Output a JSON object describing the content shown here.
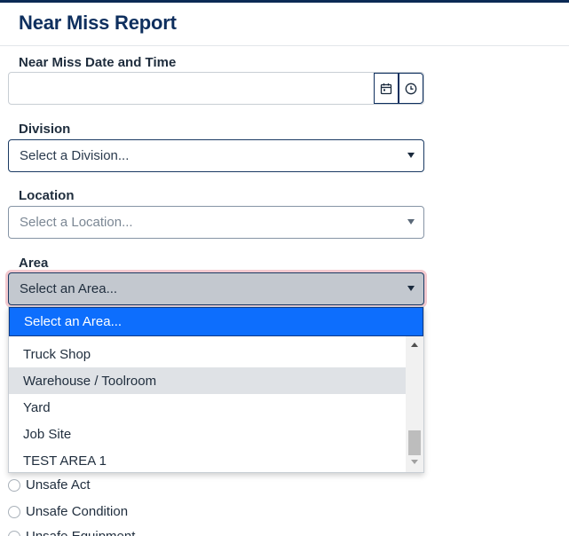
{
  "page": {
    "title": "Near Miss Report"
  },
  "datetime": {
    "label": "Near Miss Date and Time",
    "value": ""
  },
  "division": {
    "label": "Division",
    "placeholder": "Select a Division..."
  },
  "location": {
    "label": "Location",
    "placeholder": "Select a Location..."
  },
  "area": {
    "label": "Area",
    "placeholder": "Select an Area...",
    "dropdown": {
      "highlighted": "Select an Area...",
      "options": [
        "Truck Shop",
        "Warehouse / Toolroom",
        "Yard",
        "Job Site",
        "TEST AREA 1"
      ],
      "hovered": "Warehouse / Toolroom"
    }
  },
  "type_options": [
    "Unsafe Act",
    "Unsafe Condition",
    "Unsafe Equipment"
  ],
  "icons": {
    "calendar": "calendar-icon",
    "clock": "clock-icon"
  },
  "colors": {
    "brand": "#0e2f5e",
    "highlight": "#0d6efd",
    "invalid_glow": "#f3c9cf"
  }
}
